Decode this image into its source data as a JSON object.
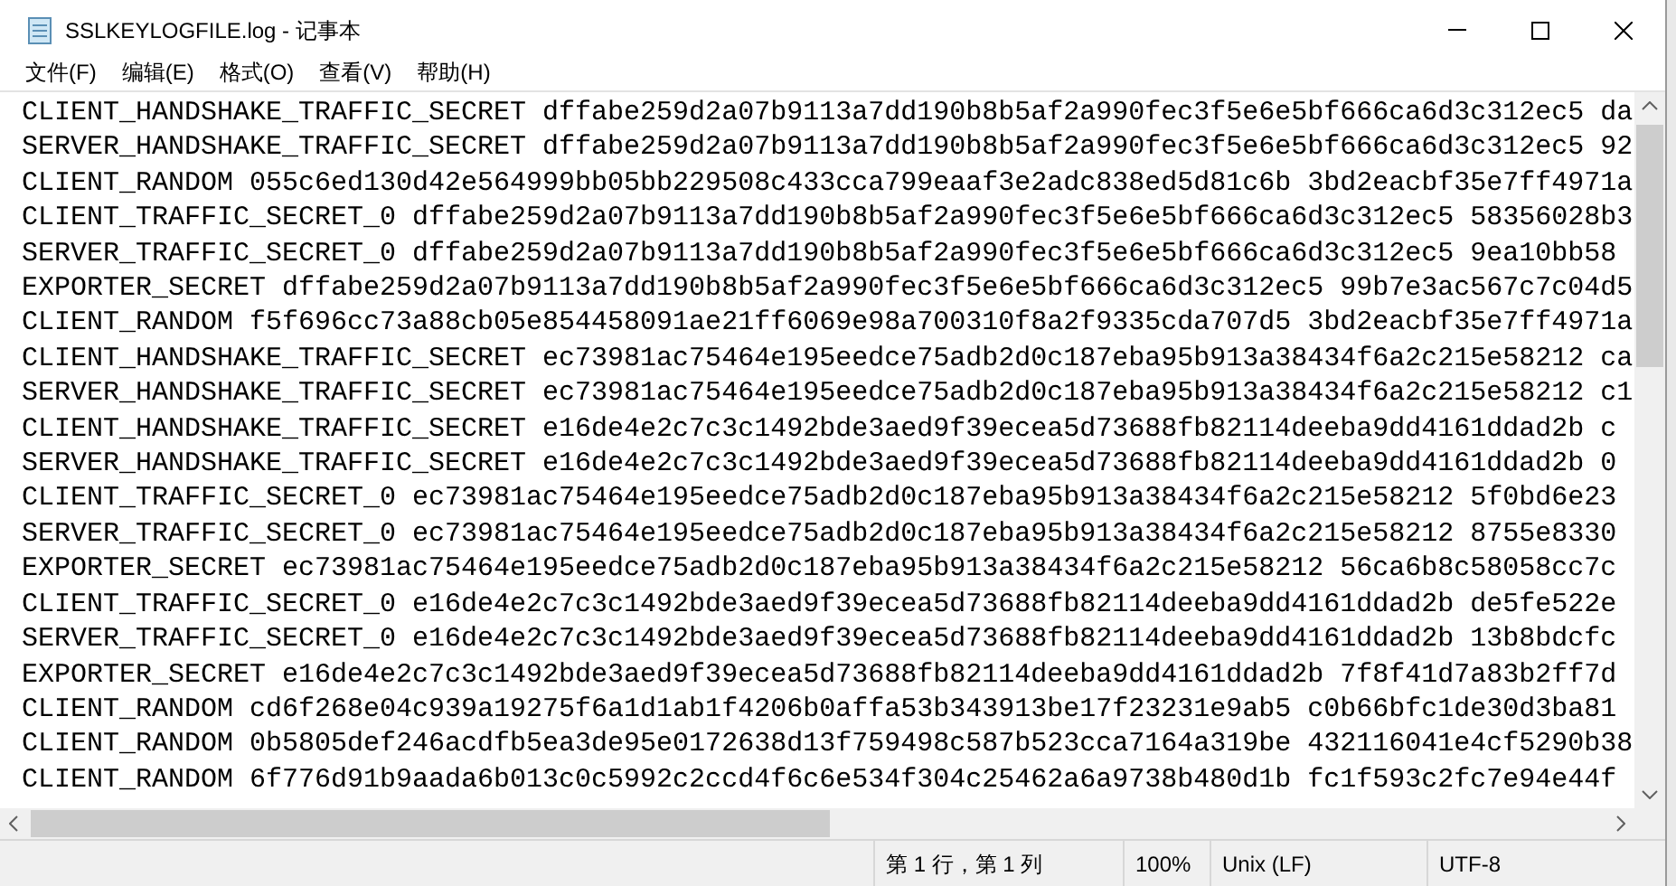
{
  "window": {
    "title": "SSLKEYLOGFILE.log - 记事本"
  },
  "menu": [
    "文件(F)",
    "编辑(E)",
    "格式(O)",
    "查看(V)",
    "帮助(H)"
  ],
  "lines": [
    "CLIENT_HANDSHAKE_TRAFFIC_SECRET dffabe259d2a07b9113a7dd190b8b5af2a990fec3f5e6e5bf666ca6d3c312ec5 da",
    "SERVER_HANDSHAKE_TRAFFIC_SECRET dffabe259d2a07b9113a7dd190b8b5af2a990fec3f5e6e5bf666ca6d3c312ec5 92",
    "CLIENT_RANDOM 055c6ed130d42e564999bb05bb229508c433cca799eaaf3e2adc838ed5d81c6b 3bd2eacbf35e7ff4971a",
    "CLIENT_TRAFFIC_SECRET_0 dffabe259d2a07b9113a7dd190b8b5af2a990fec3f5e6e5bf666ca6d3c312ec5 58356028b3",
    "SERVER_TRAFFIC_SECRET_0 dffabe259d2a07b9113a7dd190b8b5af2a990fec3f5e6e5bf666ca6d3c312ec5 9ea10bb58",
    "EXPORTER_SECRET dffabe259d2a07b9113a7dd190b8b5af2a990fec3f5e6e5bf666ca6d3c312ec5 99b7e3ac567c7c04d5",
    "CLIENT_RANDOM f5f696cc73a88cb05e854458091ae21ff6069e98a700310f8a2f9335cda707d5 3bd2eacbf35e7ff4971a",
    "CLIENT_HANDSHAKE_TRAFFIC_SECRET ec73981ac75464e195eedce75adb2d0c187eba95b913a38434f6a2c215e58212 ca",
    "SERVER_HANDSHAKE_TRAFFIC_SECRET ec73981ac75464e195eedce75adb2d0c187eba95b913a38434f6a2c215e58212 c1",
    "CLIENT_HANDSHAKE_TRAFFIC_SECRET e16de4e2c7c3c1492bde3aed9f39ecea5d73688fb82114deeba9dd4161ddad2b c",
    "SERVER_HANDSHAKE_TRAFFIC_SECRET e16de4e2c7c3c1492bde3aed9f39ecea5d73688fb82114deeba9dd4161ddad2b 0",
    "CLIENT_TRAFFIC_SECRET_0 ec73981ac75464e195eedce75adb2d0c187eba95b913a38434f6a2c215e58212 5f0bd6e23",
    "SERVER_TRAFFIC_SECRET_0 ec73981ac75464e195eedce75adb2d0c187eba95b913a38434f6a2c215e58212 8755e8330",
    "EXPORTER_SECRET ec73981ac75464e195eedce75adb2d0c187eba95b913a38434f6a2c215e58212 56ca6b8c58058cc7c",
    "CLIENT_TRAFFIC_SECRET_0 e16de4e2c7c3c1492bde3aed9f39ecea5d73688fb82114deeba9dd4161ddad2b de5fe522e",
    "SERVER_TRAFFIC_SECRET_0 e16de4e2c7c3c1492bde3aed9f39ecea5d73688fb82114deeba9dd4161ddad2b 13b8bdcfc",
    "EXPORTER_SECRET e16de4e2c7c3c1492bde3aed9f39ecea5d73688fb82114deeba9dd4161ddad2b 7f8f41d7a83b2ff7d",
    "CLIENT_RANDOM cd6f268e04c939a19275f6a1d1ab1f4206b0affa53b343913be17f23231e9ab5 c0b66bfc1de30d3ba81",
    "CLIENT_RANDOM 0b5805def246acdfb5ea3de95e0172638d13f759498c587b523cca7164a319be 432116041e4cf5290b38",
    "CLIENT_RANDOM 6f776d91b9aada6b013c0c5992c2ccd4f6c6e534f304c25462a6a9738b480d1b fc1f593c2fc7e94e44f"
  ],
  "status_bar": [
    "第 1 行，第 1 列",
    "100%",
    "Unix (LF)",
    "UTF-8"
  ]
}
